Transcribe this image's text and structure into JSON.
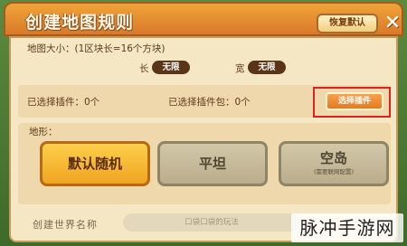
{
  "header": {
    "title": "创建地图规则",
    "reset_label": "恢复默认",
    "close_glyph": "✕"
  },
  "map_size": {
    "label": "地图大小：(1区块长=16个方块)",
    "length_label": "长",
    "length_value": "无限",
    "width_label": "宽",
    "width_value": "无限"
  },
  "plugins": {
    "selected_plugins": "已选择插件：0个",
    "selected_packs": "已选择插件包：0个",
    "select_button": "选择插件"
  },
  "terrain": {
    "label": "地形：",
    "options": [
      {
        "label": "默认随机",
        "selected": true
      },
      {
        "label": "平坦",
        "selected": false
      },
      {
        "label": "空岛",
        "sublabel": "(需要联网配置)",
        "selected": false
      }
    ]
  },
  "world_name": {
    "label": "创建世界名称",
    "placeholder": "口袋口袋的玩法"
  },
  "watermark": "脉冲手游网",
  "colors": {
    "header_orange": "#e88e30",
    "panel_cream": "#f6e7c4",
    "selected_yellow": "#f6b833",
    "highlight_red": "#e02020"
  }
}
